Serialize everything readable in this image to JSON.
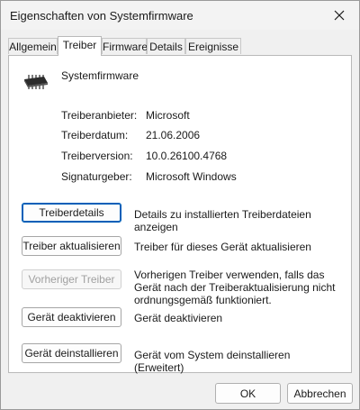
{
  "window": {
    "title": "Eigenschaften von Systemfirmware"
  },
  "tabs": [
    {
      "label": "Allgemein",
      "active": false
    },
    {
      "label": "Treiber",
      "active": true
    },
    {
      "label": "Firmware",
      "active": false
    },
    {
      "label": "Details",
      "active": false
    },
    {
      "label": "Ereignisse",
      "active": false
    }
  ],
  "device": {
    "name": "Systemfirmware",
    "icon": "chip-icon"
  },
  "driver_info": [
    {
      "label": "Treiberanbieter:",
      "value": "Microsoft"
    },
    {
      "label": "Treiberdatum:",
      "value": "21.06.2006"
    },
    {
      "label": "Treiberversion:",
      "value": "10.0.26100.4768"
    },
    {
      "label": "Signaturgeber:",
      "value": "Microsoft Windows"
    }
  ],
  "actions": [
    {
      "button": "Treiberdetails",
      "description": "Details zu installierten Treiberdateien anzeigen",
      "enabled": true,
      "focused": true
    },
    {
      "button": "Treiber aktualisieren",
      "description": "Treiber für dieses Gerät aktualisieren",
      "enabled": true
    },
    {
      "button": "Vorheriger Treiber",
      "description": "Vorherigen Treiber verwenden, falls das Gerät nach der Treiberaktualisierung nicht ordnungsgemäß funktioniert.",
      "enabled": false
    },
    {
      "button": "Gerät deaktivieren",
      "description": "Gerät deaktivieren",
      "enabled": true
    },
    {
      "button": "Gerät deinstallieren",
      "description": "Gerät vom System deinstallieren (Erweitert)",
      "enabled": true
    }
  ],
  "footer": {
    "ok_label": "OK",
    "cancel_label": "Abbrechen"
  },
  "colors": {
    "focus_border": "#005fb8",
    "window_bg": "#f0f0f0",
    "panel_bg": "#ffffff"
  }
}
